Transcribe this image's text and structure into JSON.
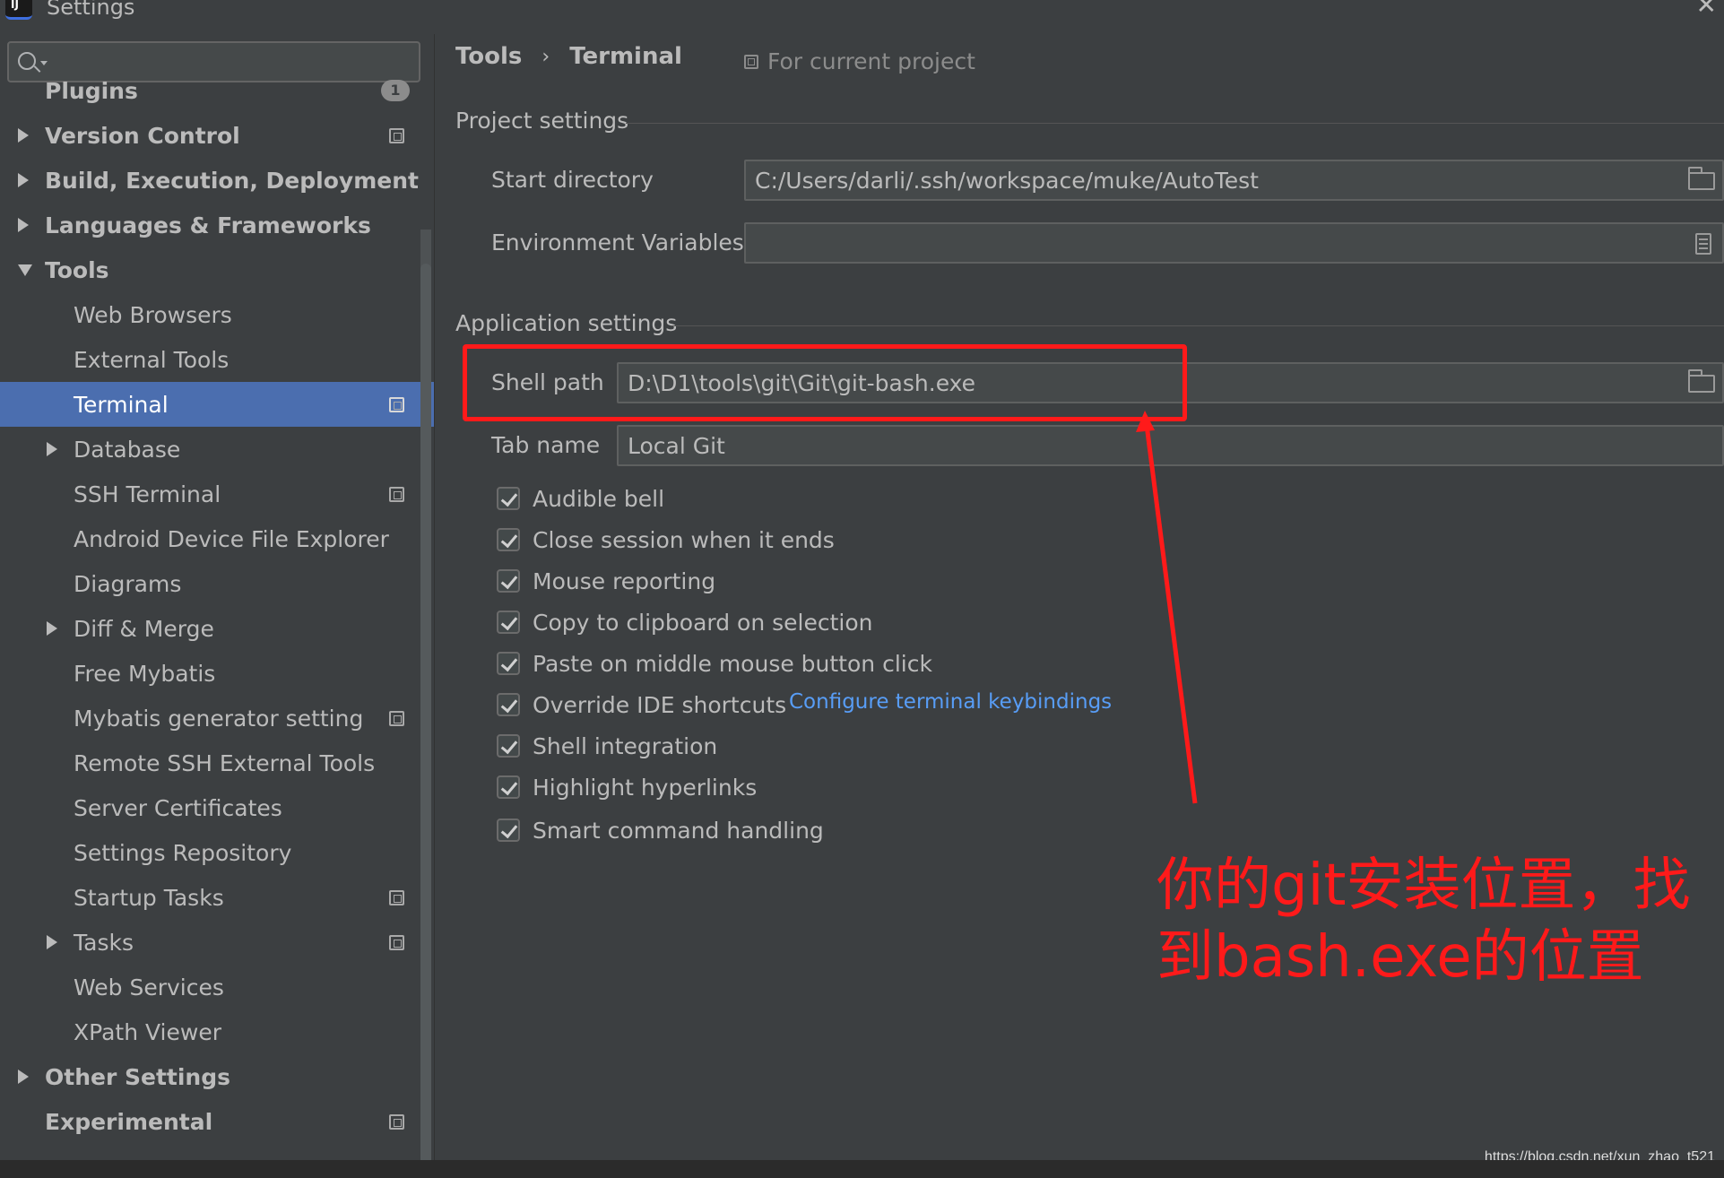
{
  "window": {
    "title": "Settings"
  },
  "search": {
    "placeholder": ""
  },
  "sidebar": {
    "items": [
      {
        "label": "Plugins",
        "bold": true,
        "badge": "1"
      },
      {
        "label": "Version Control",
        "bold": true,
        "expander": "collapsed",
        "project_icon": true
      },
      {
        "label": "Build, Execution, Deployment",
        "bold": true,
        "expander": "collapsed"
      },
      {
        "label": "Languages & Frameworks",
        "bold": true,
        "expander": "collapsed"
      },
      {
        "label": "Tools",
        "bold": true,
        "expander": "expanded"
      },
      {
        "label": "Web Browsers"
      },
      {
        "label": "External Tools"
      },
      {
        "label": "Terminal",
        "selected": true,
        "project_icon": true
      },
      {
        "label": "Database",
        "expander": "collapsed"
      },
      {
        "label": "SSH Terminal",
        "project_icon": true
      },
      {
        "label": "Android Device File Explorer"
      },
      {
        "label": "Diagrams"
      },
      {
        "label": "Diff & Merge",
        "expander": "collapsed"
      },
      {
        "label": "Free Mybatis"
      },
      {
        "label": "Mybatis generator setting",
        "project_icon": true
      },
      {
        "label": "Remote SSH External Tools"
      },
      {
        "label": "Server Certificates"
      },
      {
        "label": "Settings Repository"
      },
      {
        "label": "Startup Tasks",
        "project_icon": true
      },
      {
        "label": "Tasks",
        "expander": "collapsed",
        "project_icon": true
      },
      {
        "label": "Web Services"
      },
      {
        "label": "XPath Viewer"
      },
      {
        "label": "Other Settings",
        "bold": true,
        "expander": "collapsed"
      },
      {
        "label": "Experimental",
        "bold": true,
        "project_icon": true
      }
    ]
  },
  "breadcrumb": {
    "parent": "Tools",
    "separator": "›",
    "current": "Terminal"
  },
  "scope_hint": "For current project",
  "project_settings": {
    "title": "Project settings",
    "start_directory": {
      "label": "Start directory",
      "value": "C:/Users/darli/.ssh/workspace/muke/AutoTest"
    },
    "environment_variables": {
      "label": "Environment Variables",
      "value": ""
    }
  },
  "application_settings": {
    "title": "Application settings",
    "shell_path": {
      "label": "Shell path",
      "value": "D:\\D1\\tools\\git\\Git\\git-bash.exe"
    },
    "tab_name": {
      "label": "Tab name",
      "value": "Local Git"
    },
    "checkboxes": [
      {
        "label": "Audible bell",
        "checked": true
      },
      {
        "label": "Close session when it ends",
        "checked": true
      },
      {
        "label": "Mouse reporting",
        "checked": true
      },
      {
        "label": "Copy to clipboard on selection",
        "checked": true
      },
      {
        "label": "Paste on middle mouse button click",
        "checked": true
      },
      {
        "label": "Override IDE shortcuts",
        "checked": true
      },
      {
        "label": "Shell integration",
        "checked": true
      },
      {
        "label": "Highlight hyperlinks",
        "checked": true
      },
      {
        "label": "Smart command handling",
        "checked": true
      }
    ],
    "keybindings_link": "Configure terminal keybindings"
  },
  "annotation": {
    "line1": "你的git安装位置，找",
    "line2": "到bash.exe的位置",
    "color": "#ff1a1a"
  },
  "watermark": "https://blog.csdn.net/xun_zhao_t521",
  "colors": {
    "selection": "#4b6eaf",
    "link": "#589df6",
    "background": "#3c3f41"
  }
}
